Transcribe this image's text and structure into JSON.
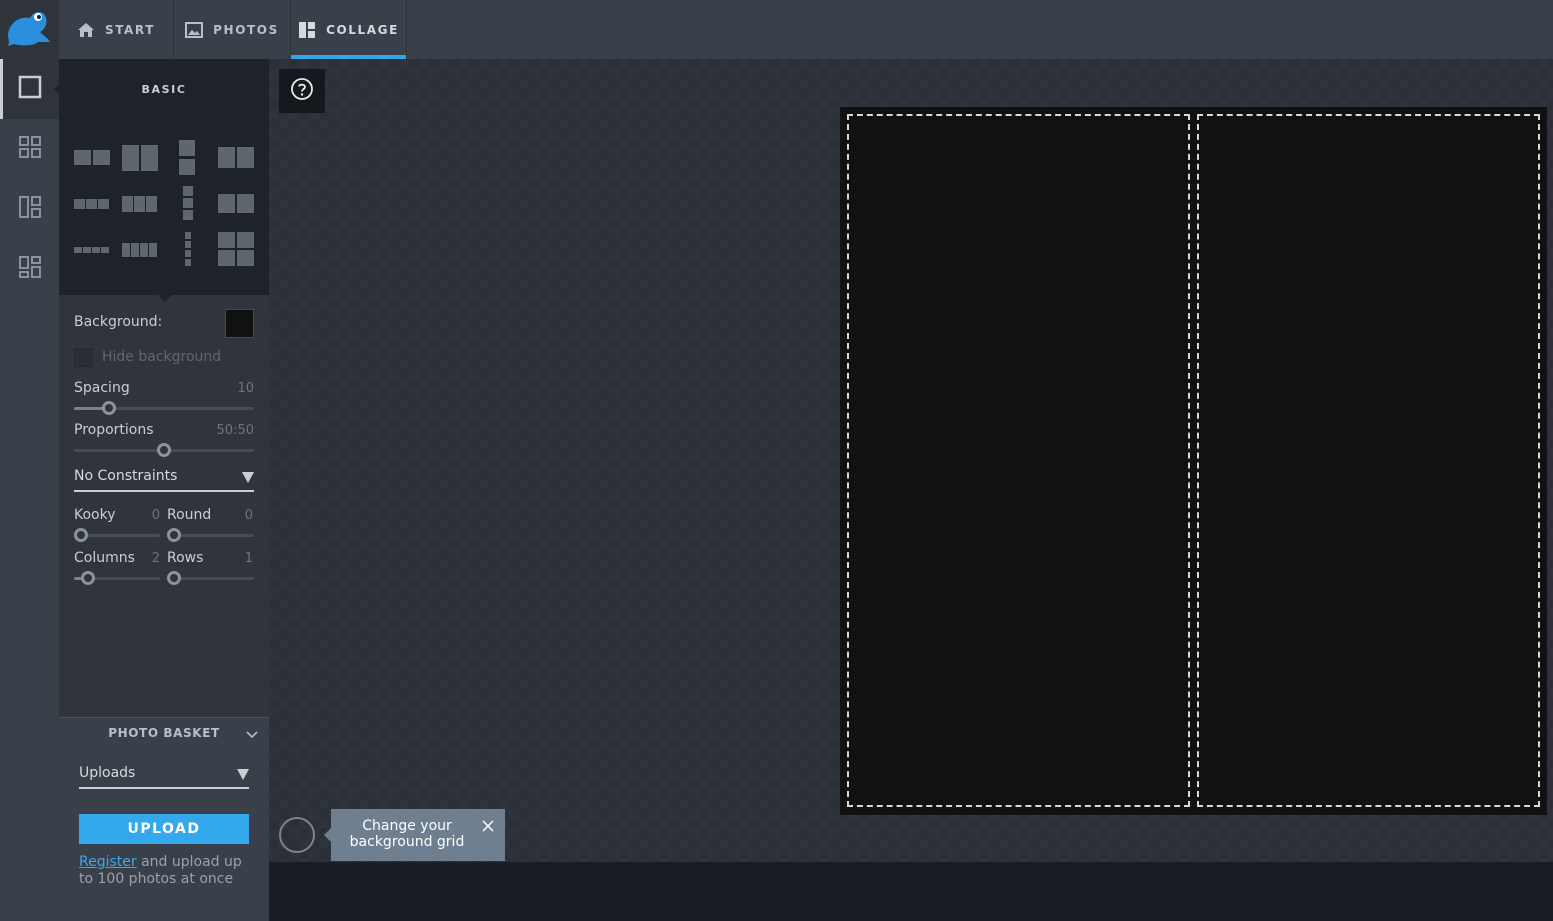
{
  "nav": {
    "tabs": [
      {
        "label": "START",
        "icon": "home-icon"
      },
      {
        "label": "PHOTOS",
        "icon": "image-icon"
      },
      {
        "label": "COLLAGE",
        "icon": "collage-icon"
      }
    ],
    "active_tab": "COLLAGE"
  },
  "rail": {
    "items": [
      "basic-layout-icon",
      "grid-layout-icon",
      "mosaic-layout-icon",
      "freestyle-layout-icon"
    ]
  },
  "panel": {
    "title": "BASIC",
    "background_label": "Background:",
    "background_color": "#111111",
    "hide_background_label": "Hide background",
    "spacing": {
      "label": "Spacing",
      "value": "10",
      "fraction": 0.17
    },
    "proportions": {
      "label": "Proportions",
      "value": "50:50",
      "fraction": 0.5
    },
    "constraints": {
      "value": "No Constraints"
    },
    "kooky": {
      "label": "Kooky",
      "value": "0",
      "fraction": 0.0
    },
    "round": {
      "label": "Round",
      "value": "0",
      "fraction": 0.0
    },
    "columns": {
      "label": "Columns",
      "value": "2",
      "fraction": 0.1
    },
    "rows": {
      "label": "Rows",
      "value": "1",
      "fraction": 0.0
    }
  },
  "basket": {
    "title": "PHOTO BASKET",
    "source": "Uploads",
    "upload_label": "UPLOAD",
    "register_link": "Register",
    "register_text": " and upload up to 100 photos at once"
  },
  "tooltip": {
    "text": "Change your background grid"
  },
  "colors": {
    "accent": "#33a8ec",
    "canvas_bg": "#111111"
  }
}
